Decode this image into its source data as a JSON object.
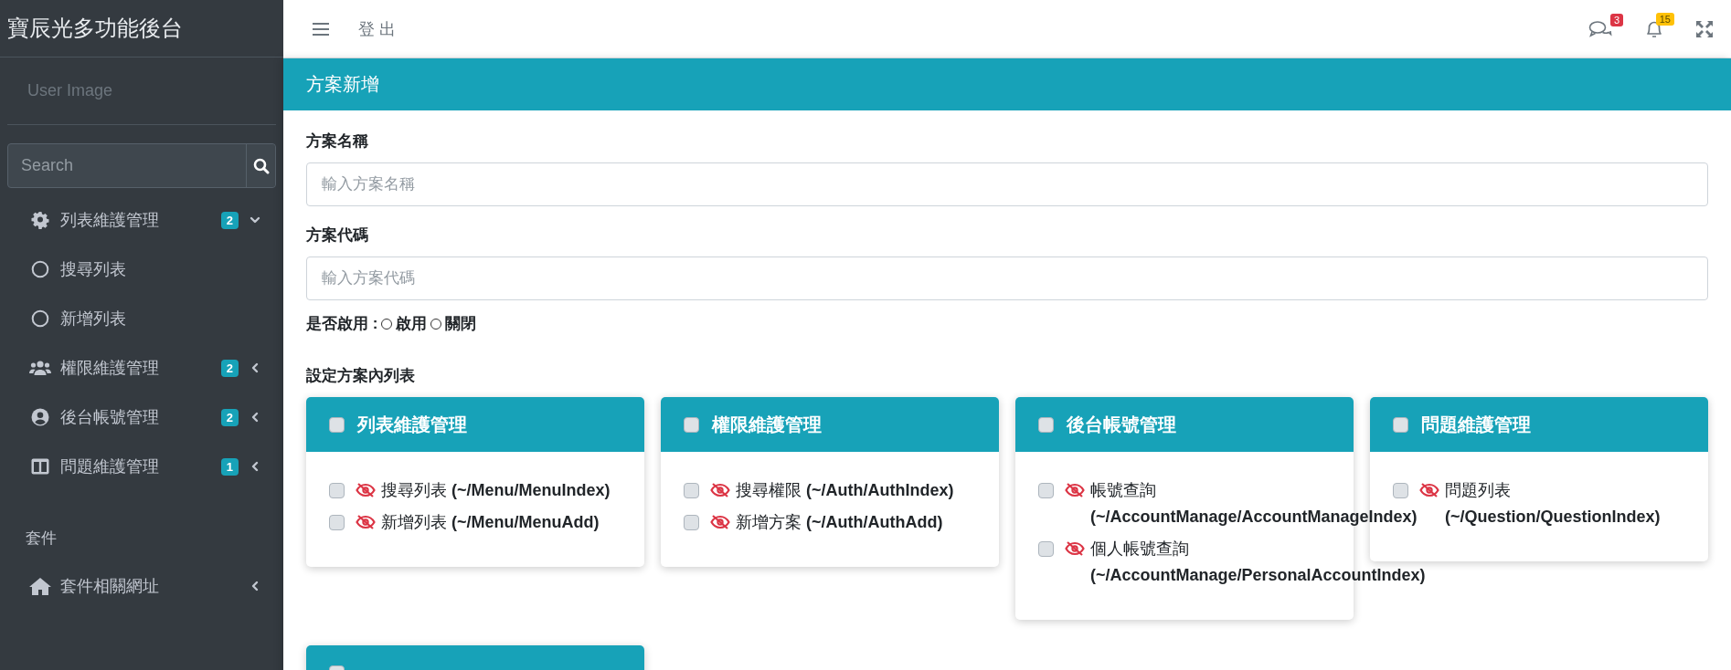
{
  "sidebar": {
    "brand": "寶辰光多功能後台",
    "user_image_alt": "User Image",
    "search": {
      "placeholder": "Search"
    },
    "menu": [
      {
        "kind": "group",
        "label": "列表維護管理",
        "badge": "2",
        "expanded": true,
        "children": [
          {
            "label": "搜尋列表"
          },
          {
            "label": "新增列表"
          }
        ]
      },
      {
        "kind": "group",
        "label": "權限維護管理",
        "badge": "2",
        "expanded": false
      },
      {
        "kind": "group",
        "label": "後台帳號管理",
        "badge": "2",
        "expanded": false
      },
      {
        "kind": "group",
        "label": "問題維護管理",
        "badge": "1",
        "expanded": false
      }
    ],
    "section_header": "套件",
    "extra_menu": [
      {
        "label": "套件相關網址",
        "expanded": false
      }
    ]
  },
  "top_bar": {
    "logout": "登 出",
    "messages_badge": "3",
    "notifications_badge": "15"
  },
  "page": {
    "title": "方案新增",
    "fields": [
      {
        "label": "方案名稱",
        "placeholder": "輸入方案名稱"
      },
      {
        "label": "方案代碼",
        "placeholder": "輸入方案代碼"
      }
    ],
    "enable": {
      "label": "是否啟用 :",
      "options": [
        {
          "label": "啟用",
          "selected": false
        },
        {
          "label": "關閉",
          "selected": false
        }
      ]
    },
    "section_title": "設定方案內列表",
    "groups": [
      {
        "title": "列表維護管理",
        "checked": false,
        "items": [
          {
            "name": "搜尋列表",
            "path": "(~/Menu/MenuIndex)",
            "checked": false,
            "hidden": true
          },
          {
            "name": "新增列表",
            "path": "(~/Menu/MenuAdd)",
            "checked": false,
            "hidden": true
          }
        ]
      },
      {
        "title": "權限維護管理",
        "checked": false,
        "items": [
          {
            "name": "搜尋權限",
            "path": "(~/Auth/AuthIndex)",
            "checked": false,
            "hidden": true
          },
          {
            "name": "新增方案",
            "path": "(~/Auth/AuthAdd)",
            "checked": false,
            "hidden": true
          }
        ]
      },
      {
        "title": "後台帳號管理",
        "checked": false,
        "items": [
          {
            "name": "帳號查詢",
            "path": "(~/AccountManage/AccountManageIndex)",
            "checked": false,
            "hidden": true
          },
          {
            "name": "個人帳號查詢",
            "path": "(~/AccountManage/PersonalAccountIndex)",
            "checked": false,
            "hidden": true
          }
        ]
      },
      {
        "title": "問題維護管理",
        "checked": false,
        "items": [
          {
            "name": "問題列表",
            "path": "(~/Question/QuestionIndex)",
            "checked": false,
            "hidden": true
          }
        ]
      },
      {
        "checked": false
      }
    ]
  }
}
